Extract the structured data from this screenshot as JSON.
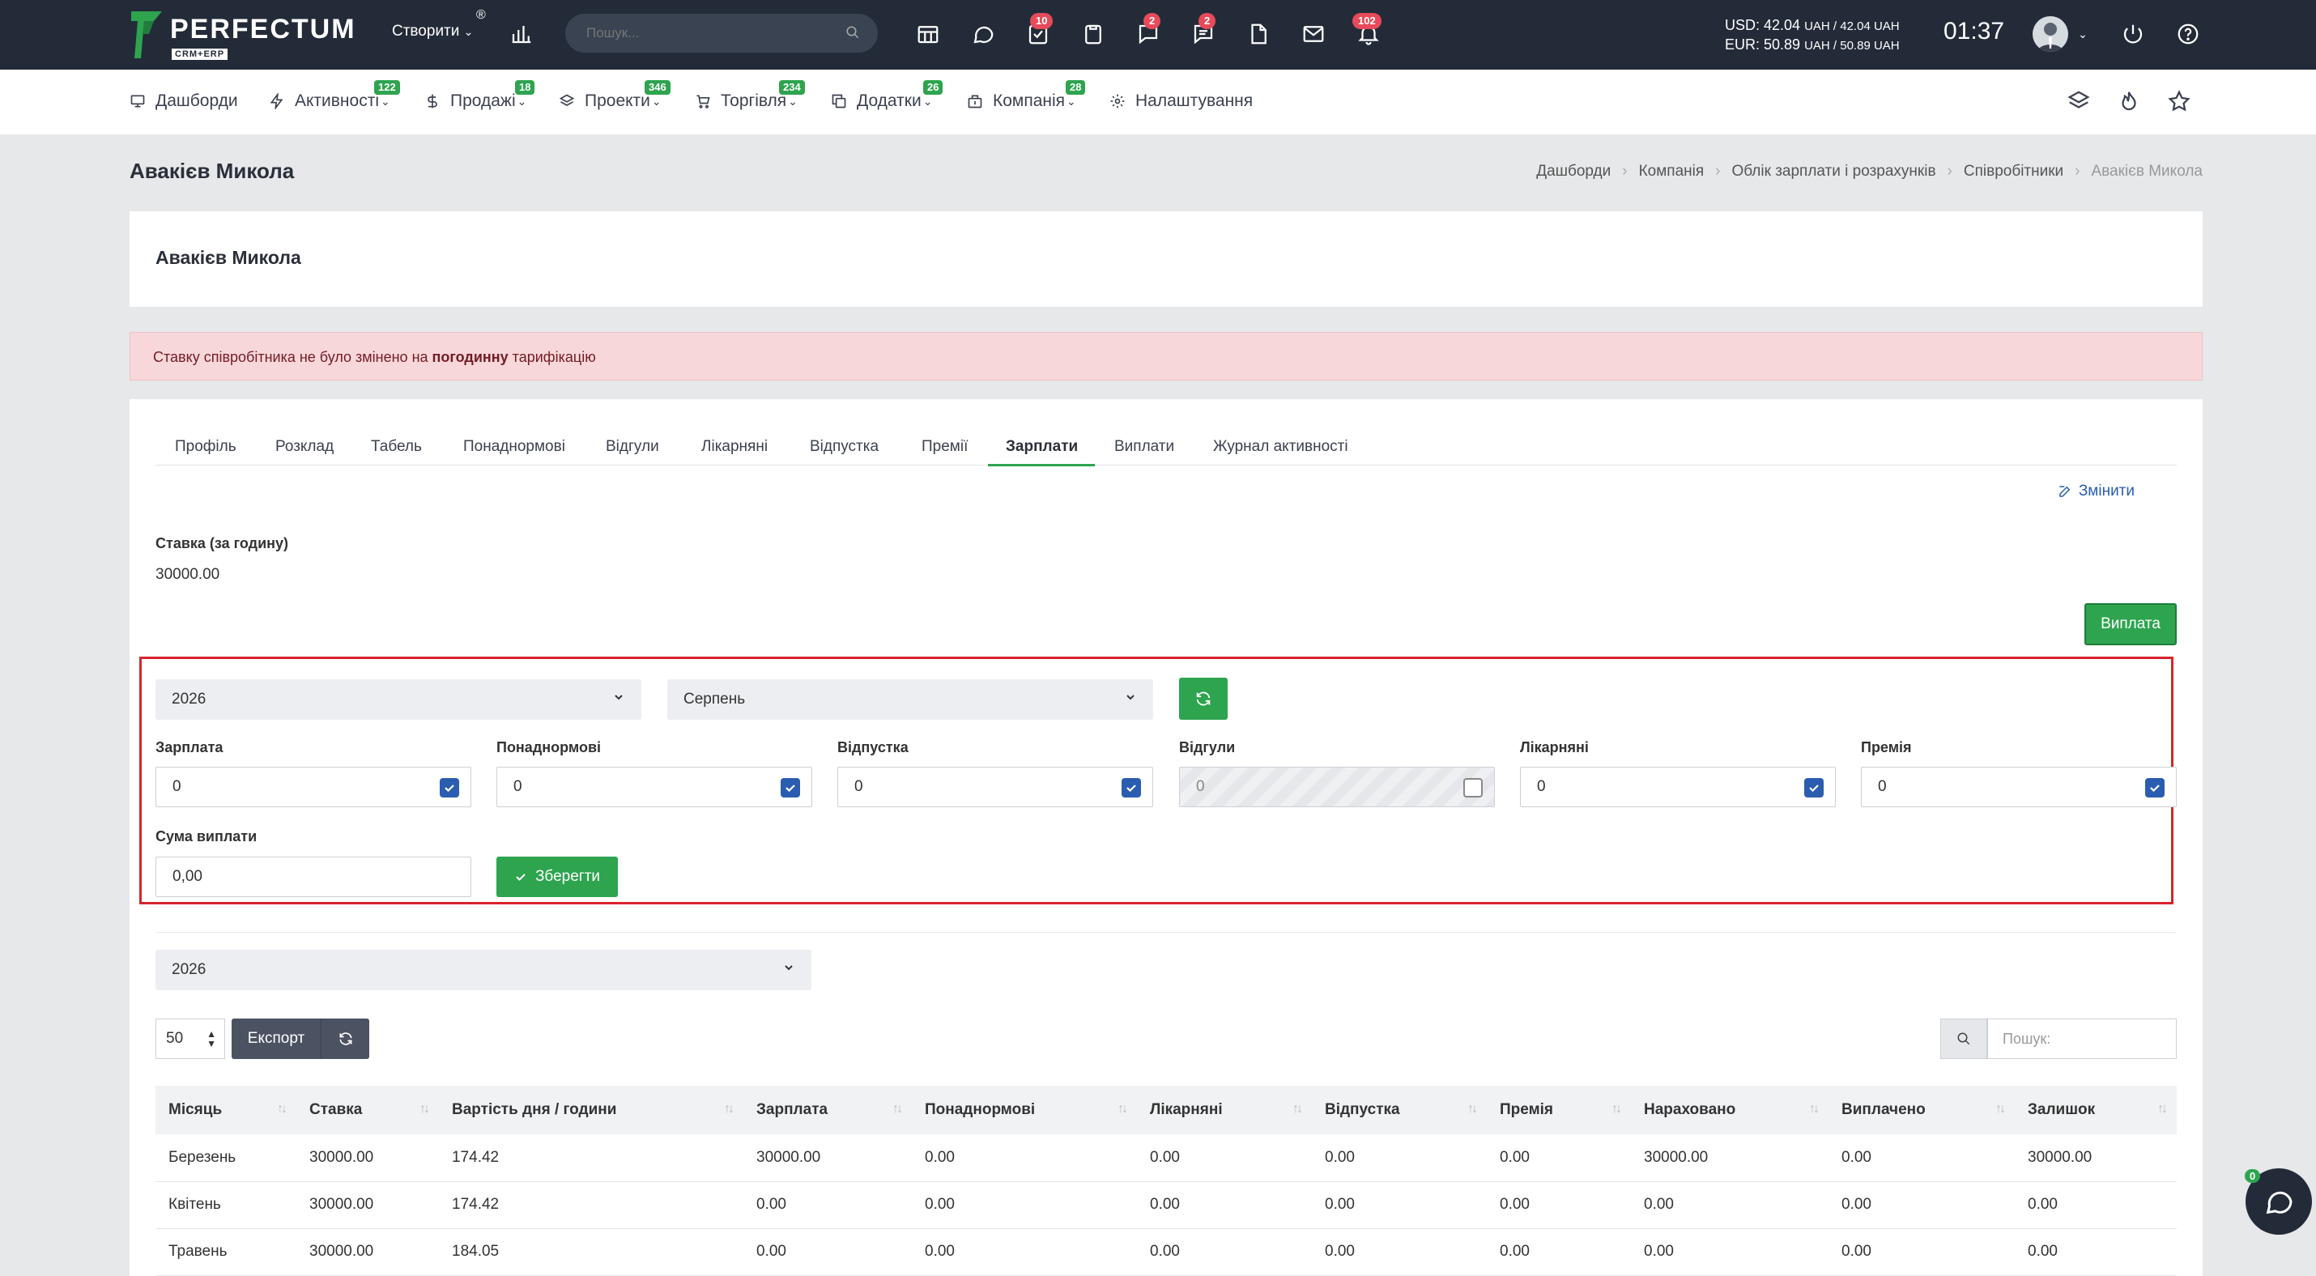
{
  "topbar": {
    "logo_name": "PERFECTUM",
    "logo_sub": "CRM+ERP",
    "logo_reg": "®",
    "create_label": "Створити",
    "search_placeholder": "Пошук...",
    "badges": {
      "tasks": "10",
      "chat": "2",
      "messages": "2",
      "notifications": "102"
    },
    "rate_usd": "USD: 42.04",
    "rate_usd_detail": "UAH / 42.04 UAH",
    "rate_eur": "EUR: 50.89",
    "rate_eur_detail": "UAH / 50.89 UAH",
    "clock": "01:37"
  },
  "nav": {
    "items": [
      {
        "label": "Дашборди",
        "icon": "monitor-icon",
        "badge": ""
      },
      {
        "label": "Активності",
        "icon": "bolt-icon",
        "badge": "122"
      },
      {
        "label": "Продажі",
        "icon": "dollar-icon",
        "badge": "18"
      },
      {
        "label": "Проекти",
        "icon": "layers-icon",
        "badge": "346"
      },
      {
        "label": "Торгівля",
        "icon": "cart-icon",
        "badge": "234"
      },
      {
        "label": "Додатки",
        "icon": "copy-icon",
        "badge": "26"
      },
      {
        "label": "Компанія",
        "icon": "building-icon",
        "badge": "28"
      },
      {
        "label": "Налаштування",
        "icon": "gear-icon",
        "badge": ""
      }
    ]
  },
  "page": {
    "title": "Авакієв Микола",
    "breadcrumb": [
      "Дашборди",
      "Компанія",
      "Облік зарплати і розрахунків",
      "Співробітники",
      "Авакієв Микола"
    ],
    "employee_name": "Авакієв Микола",
    "alert_prefix": "Ставку співробітника не було змінено на ",
    "alert_bold": "погодинну",
    "alert_suffix": " тарифікацію"
  },
  "tabs": [
    "Профіль",
    "Розклад",
    "Табель",
    "Понаднормові",
    "Відгули",
    "Лікарняні",
    "Відпустка",
    "Премії",
    "Зарплати",
    "Виплати",
    "Журнал активності"
  ],
  "active_tab": "Зарплати",
  "salary": {
    "edit_label": "Змінити",
    "rate_label": "Ставка (за годину)",
    "rate_value": "30000.00",
    "pay_button": "Виплата",
    "year": "2026",
    "month": "Серпень",
    "fields": [
      {
        "label": "Зарплата",
        "value": "0",
        "checked": true,
        "disabled": false
      },
      {
        "label": "Понаднормові",
        "value": "0",
        "checked": true,
        "disabled": false
      },
      {
        "label": "Відпустка",
        "value": "0",
        "checked": true,
        "disabled": false
      },
      {
        "label": "Відгули",
        "value": "0",
        "checked": false,
        "disabled": true
      },
      {
        "label": "Лікарняні",
        "value": "0",
        "checked": true,
        "disabled": false
      },
      {
        "label": "Премія",
        "value": "0",
        "checked": true,
        "disabled": false
      }
    ],
    "sum_label": "Сума виплати",
    "sum_value": "0,00",
    "save_button": "Зберегти"
  },
  "table": {
    "year": "2026",
    "page_length": "50",
    "export_label": "Експорт",
    "search_placeholder": "Пошук:",
    "columns": [
      "Місяць",
      "Ставка",
      "Вартість дня / години",
      "Зарплата",
      "Понаднормові",
      "Лікарняні",
      "Відпустка",
      "Премія",
      "Нараховано",
      "Виплачено",
      "Залишок"
    ],
    "rows": [
      [
        "Березень",
        "30000.00",
        "174.42",
        "30000.00",
        "0.00",
        "0.00",
        "0.00",
        "0.00",
        "30000.00",
        "0.00",
        "30000.00"
      ],
      [
        "Квітень",
        "30000.00",
        "174.42",
        "0.00",
        "0.00",
        "0.00",
        "0.00",
        "0.00",
        "0.00",
        "0.00",
        "0.00"
      ],
      [
        "Травень",
        "30000.00",
        "184.05",
        "0.00",
        "0.00",
        "0.00",
        "0.00",
        "0.00",
        "0.00",
        "0.00",
        "0.00"
      ]
    ]
  },
  "chat_badge": "0",
  "colors": {
    "green": "#2ea44f",
    "dark": "#232b38",
    "red_frame": "#d9232e",
    "badge_red": "#e74a5a",
    "link_blue": "#2a5db0"
  }
}
